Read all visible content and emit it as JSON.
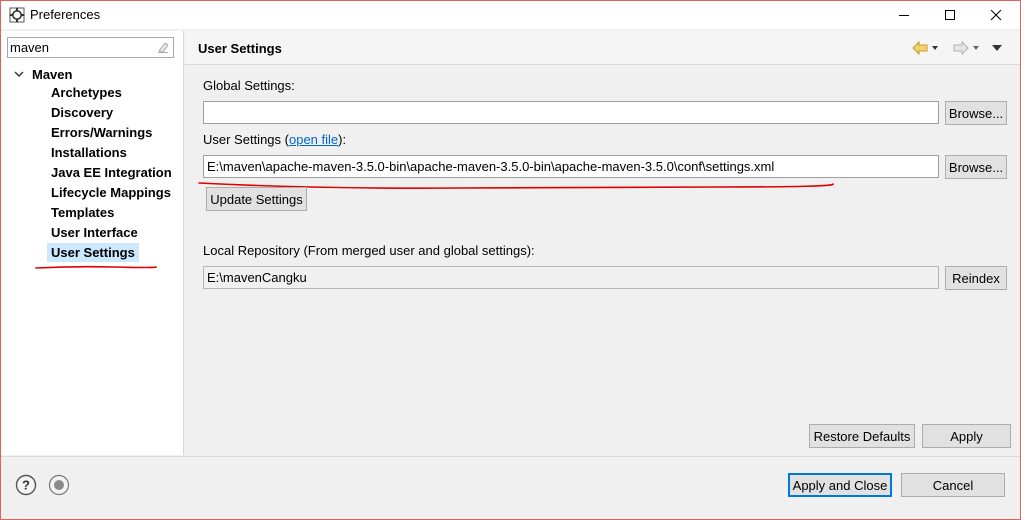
{
  "window": {
    "title": "Preferences"
  },
  "sidebar": {
    "filter_value": "maven",
    "root_label": "Maven",
    "items": [
      {
        "label": "Archetypes"
      },
      {
        "label": "Discovery"
      },
      {
        "label": "Errors/Warnings"
      },
      {
        "label": "Installations"
      },
      {
        "label": "Java EE Integration"
      },
      {
        "label": "Lifecycle Mappings"
      },
      {
        "label": "Templates"
      },
      {
        "label": "User Interface"
      },
      {
        "label": "User Settings",
        "selected": true
      }
    ]
  },
  "page": {
    "title": "User Settings",
    "global_settings_label": "Global Settings:",
    "global_settings_value": "",
    "browse_label": "Browse...",
    "user_settings_label_prefix": "User Settings (",
    "user_settings_link": "open file",
    "user_settings_label_suffix": "):",
    "user_settings_value": "E:\\maven\\apache-maven-3.5.0-bin\\apache-maven-3.5.0-bin\\apache-maven-3.5.0\\conf\\settings.xml",
    "update_settings_label": "Update Settings",
    "local_repo_label": "Local Repository (From merged user and global settings):",
    "local_repo_value": "E:\\mavenCangku",
    "reindex_label": "Reindex",
    "restore_defaults_label": "Restore Defaults",
    "apply_label": "Apply"
  },
  "footer": {
    "apply_close_label": "Apply and Close",
    "cancel_label": "Cancel"
  },
  "colors": {
    "selection": "#cce8ff",
    "annotation_red": "#e00000",
    "link": "#0066cc",
    "default_button_border": "#0078d7"
  },
  "icons": [
    "app-icon",
    "minimize-icon",
    "maximize-icon",
    "close-icon",
    "clear-filter-icon",
    "chevron-down-icon",
    "back-icon",
    "forward-icon",
    "view-menu-icon",
    "help-icon",
    "record-macro-icon"
  ]
}
